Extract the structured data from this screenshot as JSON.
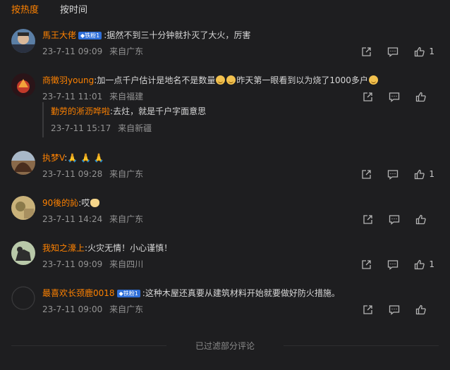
{
  "tabs": [
    {
      "label": "按热度",
      "active": true
    },
    {
      "label": "按时间",
      "active": false
    }
  ],
  "comments": [
    {
      "user": "馬王大佬",
      "badge": "铁粉1",
      "sep": ":",
      "text": "据然不到三十分钟就扑灭了大火，厉害",
      "date": "23-7-11 09:09",
      "location": "来自广东",
      "likes": "1"
    },
    {
      "user": "商徵羽young",
      "sep": ":",
      "text": "加一点千户估计是地名不是数量",
      "text2": "昨天第一眼看到以为烧了1000多户",
      "date": "23-7-11 11:01",
      "location": "来自福建",
      "likes": "",
      "reply": {
        "user": "勤劳的淅沥哗啦",
        "sep": ":",
        "text": "去炷，就是千户字面意思",
        "date": "23-7-11 15:17",
        "location": "来自新疆"
      }
    },
    {
      "user": "执梦V",
      "sep": ":",
      "text": "🙏 🙏 🙏",
      "date": "23-7-11 09:28",
      "location": "来自广东",
      "likes": "1"
    },
    {
      "user": "90後的訫",
      "sep": ":",
      "text": "哎",
      "date": "23-7-11 14:24",
      "location": "来自广东",
      "likes": ""
    },
    {
      "user": "我知之濠上",
      "sep": ":",
      "text": "火灾无情！小心谨慎！",
      "date": "23-7-11 09:09",
      "location": "来自四川",
      "likes": "1"
    },
    {
      "user": "最喜欢长颈鹿0018",
      "badge": "铁粉1",
      "sep": ":",
      "text": "这种木屋还真要从建筑材料开始就要做好防火措施。",
      "date": "23-7-11 09:00",
      "location": "来自广东",
      "likes": ""
    }
  ],
  "footer": {
    "text": "已过滤部分评论"
  },
  "icons": {
    "share": "share-icon",
    "comment": "comment-icon",
    "like": "thumbs-up-icon"
  },
  "colors": {
    "background": "#1e1e20",
    "username": "#ff8200",
    "meta": "#939393",
    "badge": "#2f6fd8"
  }
}
